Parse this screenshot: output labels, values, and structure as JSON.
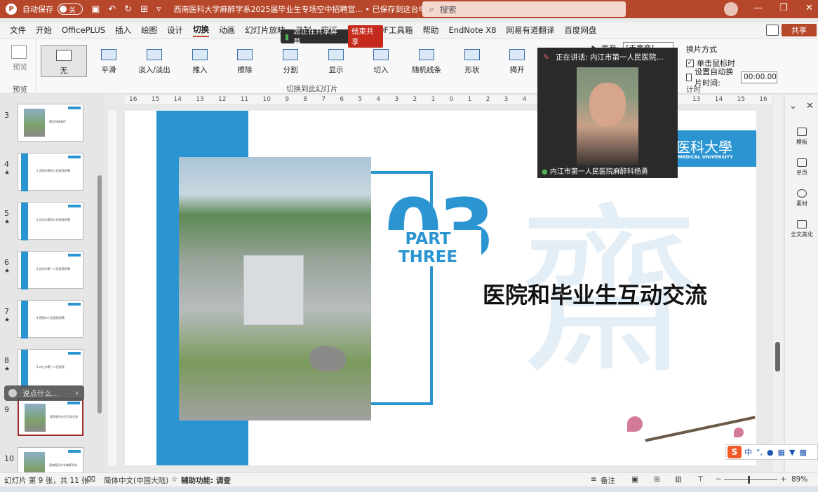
{
  "titlebar": {
    "autosave_label": "自动保存",
    "autosave_state": "关",
    "document_title": "西南医科大学麻醉学系2025届毕业生专场空中招聘宣...  • 已保存到这台电脑 ⌄",
    "search_placeholder": "搜索"
  },
  "menubar": {
    "items": [
      "文件",
      "开始",
      "OfficePLUS",
      "插入",
      "绘图",
      "设计",
      "切换",
      "动画",
      "幻灯片放映",
      "录制",
      "审阅",
      "视图",
      "PDF工具箱",
      "帮助",
      "EndNote X8",
      "网易有道翻译",
      "百度网盘"
    ],
    "active": "切换",
    "share_label": "共享"
  },
  "screen_share": {
    "message": "您正在共享屏幕",
    "stop_label": "结束共享"
  },
  "ribbon": {
    "preview_label": "预览",
    "preview_group_label": "预览",
    "transitions_group_label": "切换到此幻灯片",
    "transitions": [
      "无",
      "平滑",
      "淡入/淡出",
      "推入",
      "擦除",
      "分割",
      "显示",
      "切入",
      "随机线条",
      "形状",
      "揭开"
    ],
    "selected_transition": "无",
    "sound_label": "声音:",
    "sound_value": "[无声音]",
    "advance_label": "换片方式",
    "on_click_label": "单击鼠标时",
    "on_click_checked": true,
    "after_label": "设置自动换片时间:",
    "after_checked": false,
    "after_value": "00:00.00",
    "timing_group_label": "计时"
  },
  "slides_panel": {
    "thumbnails": [
      {
        "num": "3",
        "star": "",
        "text": "教学科研条件"
      },
      {
        "num": "4",
        "star": "★",
        "text": "1.资阳市第四人民医院招聘"
      },
      {
        "num": "5",
        "star": "★",
        "text": "2.自贡市第四人民医院招聘"
      },
      {
        "num": "6",
        "star": "★",
        "text": "3.自贡市第一人民医院招聘"
      },
      {
        "num": "7",
        "star": "★",
        "text": "4.德阳市人民医院招聘"
      },
      {
        "num": "8",
        "star": "★",
        "text": "5.内江市第一人民医院"
      },
      {
        "num": "9",
        "star": "",
        "text": "医院和毕业生互动交流"
      },
      {
        "num": "10",
        "star": "",
        "text": "西南医科大学麻醉学系"
      }
    ],
    "chat_placeholder": "说点什么..."
  },
  "ruler": {
    "ticks": [
      "16",
      "15",
      "14",
      "13",
      "12",
      "11",
      "10",
      "9",
      "8",
      "7",
      "6",
      "5",
      "4",
      "3",
      "2",
      "1",
      "0",
      "1",
      "2",
      "3",
      "4",
      "5",
      "13",
      "14",
      "15",
      "16"
    ]
  },
  "slide": {
    "big_number": "03",
    "part_label": "PART THREE",
    "heading": "医院和毕业生互动交流",
    "university_cn": "医科大學",
    "university_en": "MEDICAL UNIVERSITY",
    "watermark": "齋",
    "accent_color": "#2b95d2"
  },
  "video": {
    "speaking_label": "正在讲话:",
    "speaking_name": "内江市第一人民医院...",
    "participant_name": "内江市第一人民医院麻醉科杨勇"
  },
  "right_pane": {
    "items": [
      "模板",
      "单页",
      "素材",
      "全文美化"
    ]
  },
  "ime": {
    "mode": "中"
  },
  "statusbar": {
    "slide_info": "幻灯片 第 9 张，共 11 张",
    "language": "简体中文(中国大陆)",
    "accessibility": "辅助功能: 调查",
    "notes": "备注",
    "zoom": "89%",
    "zoom_level": 0.89
  }
}
